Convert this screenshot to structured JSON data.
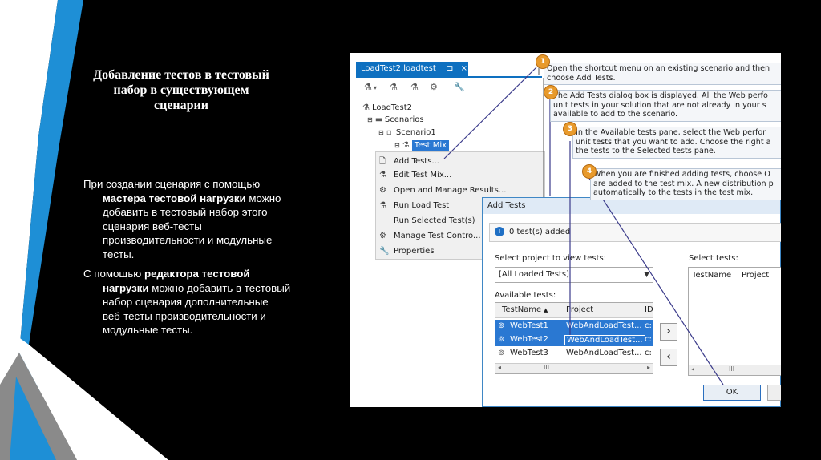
{
  "slide": {
    "title": "Добавление тестов в тестовый набор в существующем сценарии",
    "para1": {
      "t1": "При создании сценария с помощью ",
      "b1": "мастера тестовой нагрузки",
      "t2": " можно добавить в тестовый набор этого сценария веб-тесты производительности и модульные тесты."
    },
    "para2": {
      "t1": "С помощью ",
      "b1": "редактора тестовой нагрузки",
      "t2": " можно добавить в тестовый набор сценария дополнительные веб-тесты производительности и модульные тесты."
    },
    "colors": {
      "accent_blue": "#1e8fd6",
      "stripe_white": "#ffffff",
      "stripe_gray": "#8a8a8a"
    }
  },
  "screenshot": {
    "tab_label": "LoadTest2.loadtest",
    "tab_pin": "⊐",
    "tab_close": "×",
    "tree": {
      "root": "LoadTest2",
      "scenarios": "Scenarios",
      "scenario": "Scenario1",
      "testmix": "Test Mix"
    },
    "menu": [
      "Add Tests...",
      "Edit Test Mix...",
      "Open and Manage Results...",
      "Run Load Test",
      "Run Selected Test(s)",
      "Manage Test Contro...",
      "Properties"
    ],
    "callouts": [
      {
        "n": "1",
        "lines": [
          "Open the shortcut menu on an existing scenario and then",
          "choose Add Tests."
        ]
      },
      {
        "n": "2",
        "lines": [
          "The Add Tests dialog box is displayed. All the Web perfo",
          "unit tests in your solution that are not already in your s",
          "available to add to the scenario."
        ]
      },
      {
        "n": "3",
        "lines": [
          "In the Available tests pane, select the Web perfor",
          "unit tests that you want to add. Choose the right a",
          "the tests to the Selected tests pane."
        ]
      },
      {
        "n": "4",
        "lines": [
          "When you are finished adding tests, choose O",
          "are added to the test mix. A new distribution p",
          "automatically to the tests in the test mix."
        ]
      }
    ],
    "dialog": {
      "title": "Add Tests",
      "info": "0 test(s) added",
      "select_project_label": "Select project to view tests:",
      "project_value": "[All Loaded Tests]",
      "available_label": "Available tests:",
      "select_tests_label": "Select tests:",
      "col_testname": "TestName",
      "col_project": "Project",
      "col_id": "ID",
      "rows": [
        {
          "name": "WebTest1",
          "project": "WebAndLoadTest...",
          "id": "c:"
        },
        {
          "name": "WebTest2",
          "project": "WebAndLoadTest...",
          "id": "c:"
        },
        {
          "name": "WebTest3",
          "project": "WebAndLoadTest...",
          "id": "c:"
        }
      ],
      "sel_col_testname": "TestName",
      "sel_col_project": "Project",
      "scroll_mark": "III",
      "ok_label": "OK"
    }
  }
}
